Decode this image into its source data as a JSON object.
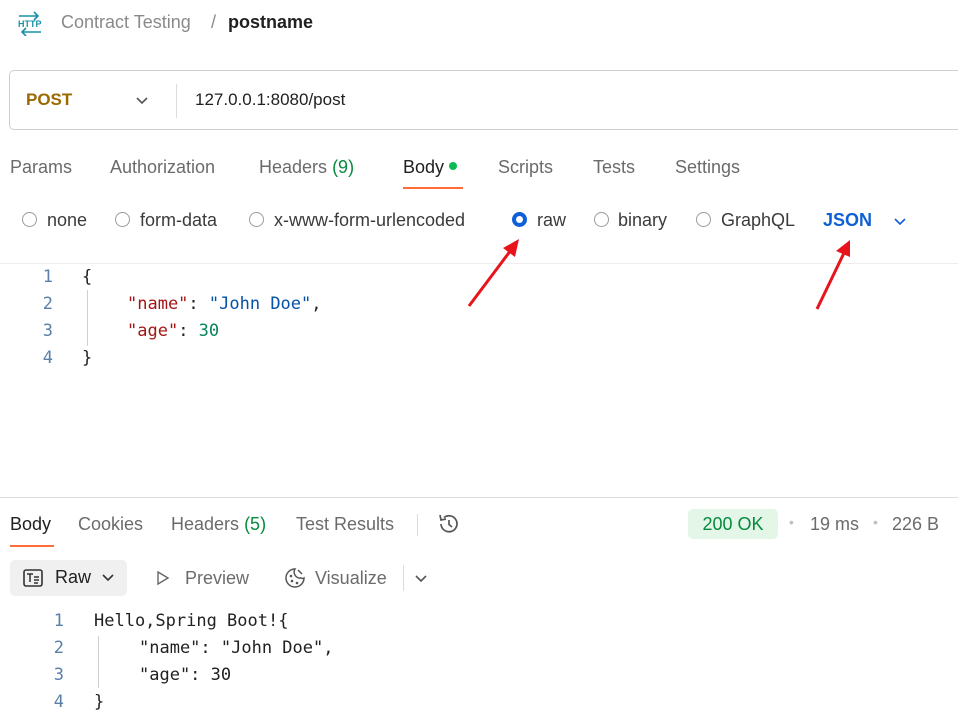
{
  "breadcrumb": {
    "parent": "Contract Testing",
    "separator": "/",
    "current": "postname",
    "icon": "http-icon"
  },
  "request": {
    "method": "POST",
    "url": "127.0.0.1:8080/post"
  },
  "request_tabs": [
    {
      "label": "Params"
    },
    {
      "label": "Authorization"
    },
    {
      "label": "Headers",
      "count": "(9)"
    },
    {
      "label": "Body",
      "active": true,
      "indicator": "green-dot"
    },
    {
      "label": "Scripts"
    },
    {
      "label": "Tests"
    },
    {
      "label": "Settings"
    }
  ],
  "body_modes": {
    "options": [
      "none",
      "form-data",
      "x-www-form-urlencoded",
      "raw",
      "binary",
      "GraphQL"
    ],
    "selected": "raw",
    "format": "JSON"
  },
  "request_body": {
    "line_numbers": [
      "1",
      "2",
      "3",
      "4"
    ],
    "open_brace": "{",
    "name_key": "\"name\"",
    "name_colon": ": ",
    "name_value": "\"John Doe\"",
    "comma": ",",
    "age_key": "\"age\"",
    "age_colon": ": ",
    "age_value": "30",
    "close_brace": "}"
  },
  "response_tabs": [
    {
      "label": "Body",
      "active": true
    },
    {
      "label": "Cookies"
    },
    {
      "label": "Headers",
      "count": "(5)"
    },
    {
      "label": "Test Results"
    }
  ],
  "response_meta": {
    "status": "200 OK",
    "time": "19 ms",
    "size": "226 B",
    "dot": "•"
  },
  "response_view": {
    "raw_label": "Raw",
    "preview_label": "Preview",
    "visualize_label": "Visualize"
  },
  "response_body": {
    "line_numbers": [
      "1",
      "2",
      "3",
      "4"
    ],
    "line1": "Hello,Spring Boot!{",
    "line2": "\"name\": \"John Doe\",",
    "line3": "\"age\": 30",
    "line4": "}"
  },
  "colors": {
    "accent": "#ff6c37",
    "method": "#9a6a00",
    "link_blue": "#0f5fd7",
    "status_green": "#078a3e",
    "arrow": "#e8141c"
  }
}
